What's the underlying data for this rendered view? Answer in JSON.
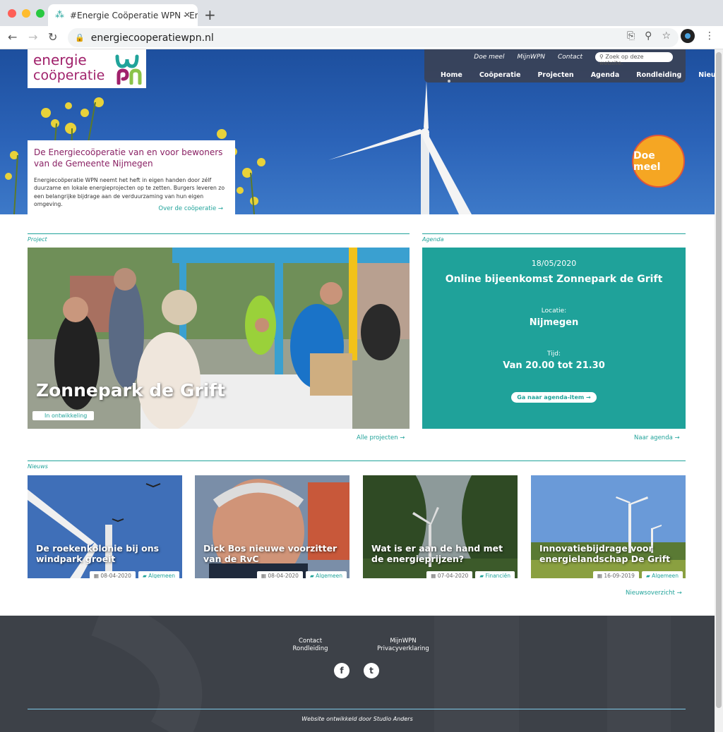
{
  "browser": {
    "tab_title": "#Energie Coöperatie WPN - En",
    "url": "energiecooperatiewpn.nl"
  },
  "header": {
    "logo_line1": "energie",
    "logo_line2": "coöperatie",
    "top_links": [
      "Doe meel",
      "MijnWPN",
      "Contact"
    ],
    "search_placeholder": "Zoek op deze website.",
    "nav": [
      "Home",
      "Coöperatie",
      "Projecten",
      "Agenda",
      "Rondleiding",
      "Nieuws"
    ],
    "active_nav": "Home"
  },
  "hero": {
    "title": "De Energiecoöperatie van en voor bewoners van de Gemeente Nijmegen",
    "text": "Energiecoöperatie WPN neemt het heft in eigen handen door zélf duurzame en lokale energieprojecten op te zetten. Burgers leveren zo een belangrijke bijdrage aan de verduurzaming van hun eigen omgeving.",
    "link": "Over de coöperatie →",
    "cta": "Doe meel"
  },
  "project": {
    "section_label": "Project",
    "title": "Zonnepark de Grift",
    "status": "In ontwikkeling",
    "all_link": "Alle projecten →"
  },
  "agenda": {
    "section_label": "Agenda",
    "date": "18/05/2020",
    "title": "Online bijeenkomst Zonnepark de Grift",
    "location_label": "Locatie:",
    "location": "Nijmegen",
    "time_label": "Tijd:",
    "time": "Van 20.00 tot 21.30",
    "button": "Ga naar agenda-item →",
    "all_link": "Naar agenda →"
  },
  "news": {
    "section_label": "Nieuws",
    "items": [
      {
        "title": "De roekenkolonie bij ons windpark groeit",
        "date": "08-04-2020",
        "category": "Algemeen"
      },
      {
        "title": "Dick Bos nieuwe voorzitter van de RvC",
        "date": "08-04-2020",
        "category": "Algemeen"
      },
      {
        "title": "Wat is er aan de hand met de energieprijzen?",
        "date": "07-04-2020",
        "category": "Financiën"
      },
      {
        "title": "Innovatiebijdrage voor energielandschap De Grift",
        "date": "16-09-2019",
        "category": "Algemeen"
      }
    ],
    "all_link": "Nieuwsoverzicht →"
  },
  "footer": {
    "col1": [
      "Contact",
      "Rondleiding"
    ],
    "col2": [
      "MijnWPN",
      "Privacyverklaring"
    ],
    "credit": "Website ontwikkeld door Studio Anders"
  },
  "colors": {
    "accent": "#20a39a",
    "brand": "#a0216b",
    "cta": "#f5a623",
    "footer": "#3d4148"
  }
}
